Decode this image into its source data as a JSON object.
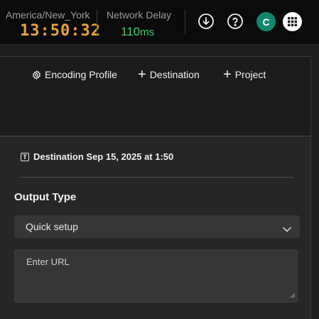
{
  "header": {
    "timezone": "America/New_York",
    "clock": "13:50:32",
    "network_delay_label": "Network Delay",
    "network_delay_value": "110",
    "network_delay_unit": "ms",
    "avatar_initial": "C",
    "icons": [
      "download-icon",
      "help-icon",
      "apps-grid-icon"
    ]
  },
  "toolbar": {
    "encoding_profile": "Encoding Profile",
    "destination": "Destination",
    "project": "Project"
  },
  "destination_panel": {
    "title": "Destination Sep 15, 2025 at 1:50",
    "title_icon_letter": "T",
    "output_type_label": "Output Type",
    "output_type_value": "Quick setup",
    "url_placeholder": "Enter URL"
  },
  "colors": {
    "clock": "#e8a23b",
    "network_delay": "#3fce6a",
    "avatar": "#12876d"
  }
}
